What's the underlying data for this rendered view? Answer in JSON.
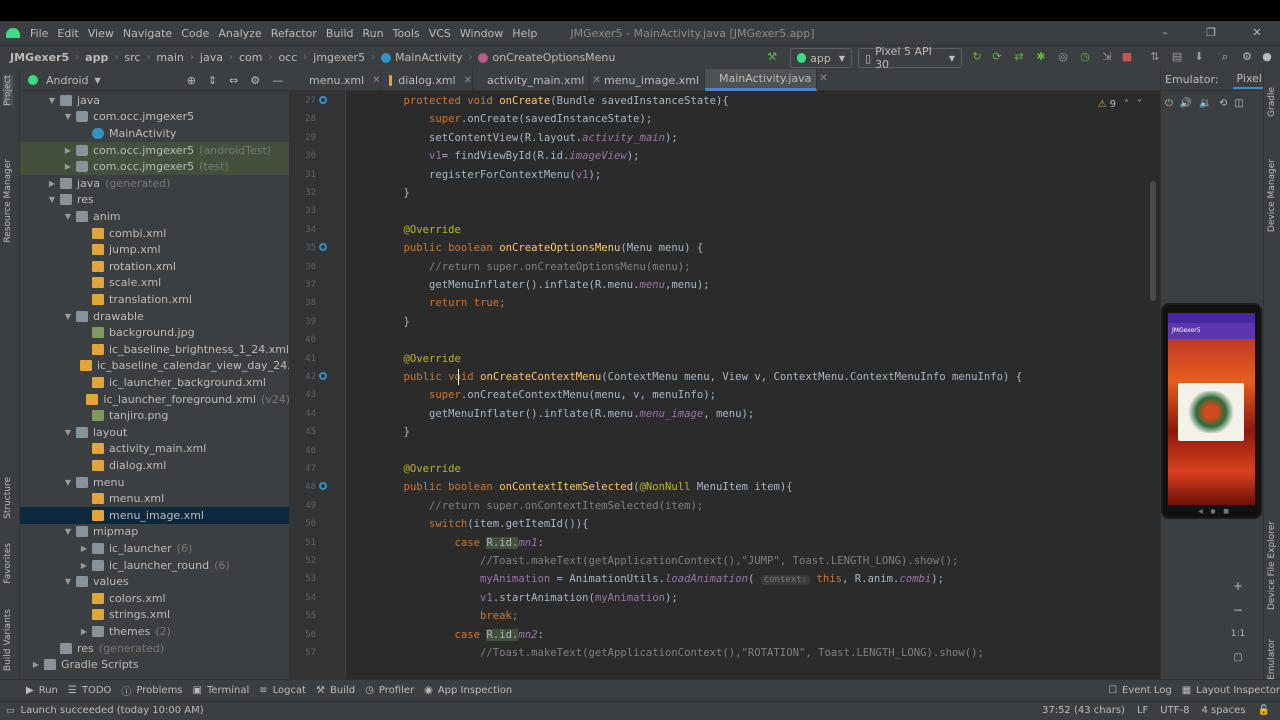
{
  "window": {
    "title": "JMGexer5 - MainActivity.java [JMGexer5.app]",
    "menu": [
      "File",
      "Edit",
      "View",
      "Navigate",
      "Code",
      "Analyze",
      "Refactor",
      "Build",
      "Run",
      "Tools",
      "VCS",
      "Window",
      "Help"
    ],
    "controls": {
      "minimize": "–",
      "restore": "❐",
      "close": "✕"
    }
  },
  "breadcrumb": [
    "JMGexer5",
    "app",
    "src",
    "main",
    "java",
    "com",
    "occ",
    "jmgexer5",
    "MainActivity",
    "onCreateOptionsMenu"
  ],
  "toolbar": {
    "run_config": "app",
    "device": "Pixel 5 API 30"
  },
  "project_panel": {
    "view": "Android",
    "tree": [
      {
        "label": "java",
        "depth": 2,
        "icon": "folder-icon",
        "arrow": "▼",
        "suffix": ""
      },
      {
        "label": "com.occ.jmgexer5",
        "depth": 3,
        "icon": "package-icon",
        "arrow": "▼",
        "suffix": ""
      },
      {
        "label": "MainActivity",
        "depth": 4,
        "icon": "class-icon",
        "arrow": "",
        "suffix": ""
      },
      {
        "label": "com.occ.jmgexer5",
        "depth": 3,
        "icon": "package-icon",
        "arrow": "▶",
        "suffix": "(androidTest)",
        "hl": true
      },
      {
        "label": "com.occ.jmgexer5",
        "depth": 3,
        "icon": "package-icon",
        "arrow": "▶",
        "suffix": "(test)",
        "hl": true
      },
      {
        "label": "java",
        "depth": 2,
        "icon": "folder-icon",
        "arrow": "▶",
        "suffix": "(generated)"
      },
      {
        "label": "res",
        "depth": 2,
        "icon": "folder-icon",
        "arrow": "▼",
        "suffix": ""
      },
      {
        "label": "anim",
        "depth": 3,
        "icon": "folder-icon",
        "arrow": "▼",
        "suffix": ""
      },
      {
        "label": "combi.xml",
        "depth": 4,
        "icon": "xml-icon",
        "arrow": "",
        "suffix": ""
      },
      {
        "label": "jump.xml",
        "depth": 4,
        "icon": "xml-icon",
        "arrow": "",
        "suffix": ""
      },
      {
        "label": "rotation.xml",
        "depth": 4,
        "icon": "xml-icon",
        "arrow": "",
        "suffix": ""
      },
      {
        "label": "scale.xml",
        "depth": 4,
        "icon": "xml-icon",
        "arrow": "",
        "suffix": ""
      },
      {
        "label": "translation.xml",
        "depth": 4,
        "icon": "xml-icon",
        "arrow": "",
        "suffix": ""
      },
      {
        "label": "drawable",
        "depth": 3,
        "icon": "folder-icon",
        "arrow": "▼",
        "suffix": ""
      },
      {
        "label": "background.jpg",
        "depth": 4,
        "icon": "image-icon",
        "arrow": "",
        "suffix": ""
      },
      {
        "label": "ic_baseline_brightness_1_24.xml",
        "depth": 4,
        "icon": "xml-icon",
        "arrow": "",
        "suffix": ""
      },
      {
        "label": "ic_baseline_calendar_view_day_24.xml",
        "depth": 4,
        "icon": "xml-icon",
        "arrow": "",
        "suffix": ""
      },
      {
        "label": "ic_launcher_background.xml",
        "depth": 4,
        "icon": "xml-icon",
        "arrow": "",
        "suffix": ""
      },
      {
        "label": "ic_launcher_foreground.xml",
        "depth": 4,
        "icon": "xml-icon",
        "arrow": "",
        "suffix": "(v24)"
      },
      {
        "label": "tanjiro.png",
        "depth": 4,
        "icon": "image-icon",
        "arrow": "",
        "suffix": ""
      },
      {
        "label": "layout",
        "depth": 3,
        "icon": "folder-icon",
        "arrow": "▼",
        "suffix": ""
      },
      {
        "label": "activity_main.xml",
        "depth": 4,
        "icon": "xml-icon",
        "arrow": "",
        "suffix": ""
      },
      {
        "label": "dialog.xml",
        "depth": 4,
        "icon": "xml-icon",
        "arrow": "",
        "suffix": ""
      },
      {
        "label": "menu",
        "depth": 3,
        "icon": "folder-icon",
        "arrow": "▼",
        "suffix": ""
      },
      {
        "label": "menu.xml",
        "depth": 4,
        "icon": "xml-icon",
        "arrow": "",
        "suffix": ""
      },
      {
        "label": "menu_image.xml",
        "depth": 4,
        "icon": "xml-icon",
        "arrow": "",
        "suffix": "",
        "sel": true
      },
      {
        "label": "mipmap",
        "depth": 3,
        "icon": "folder-icon",
        "arrow": "▼",
        "suffix": ""
      },
      {
        "label": "ic_launcher",
        "depth": 4,
        "icon": "folder-icon",
        "arrow": "▶",
        "suffix": "(6)"
      },
      {
        "label": "ic_launcher_round",
        "depth": 4,
        "icon": "folder-icon",
        "arrow": "▶",
        "suffix": "(6)"
      },
      {
        "label": "values",
        "depth": 3,
        "icon": "folder-icon",
        "arrow": "▼",
        "suffix": ""
      },
      {
        "label": "colors.xml",
        "depth": 4,
        "icon": "xml-icon",
        "arrow": "",
        "suffix": ""
      },
      {
        "label": "strings.xml",
        "depth": 4,
        "icon": "xml-icon",
        "arrow": "",
        "suffix": ""
      },
      {
        "label": "themes",
        "depth": 4,
        "icon": "folder-icon",
        "arrow": "▶",
        "suffix": "(2)"
      },
      {
        "label": "res",
        "depth": 2,
        "icon": "folder-icon",
        "arrow": "",
        "suffix": "(generated)"
      },
      {
        "label": "Gradle Scripts",
        "depth": 1,
        "icon": "gradle-icon",
        "arrow": "▶",
        "suffix": ""
      }
    ]
  },
  "left_strip": [
    "Project",
    "Resource Manager",
    "Structure",
    "Favorites",
    "Build Variants"
  ],
  "right_strip": [
    "Gradle",
    "Device Manager",
    "Device File Explorer",
    "Emulator"
  ],
  "tabs": [
    {
      "label": "menu.xml",
      "active": false
    },
    {
      "label": "dialog.xml",
      "active": false
    },
    {
      "label": "activity_main.xml",
      "active": false
    },
    {
      "label": "menu_image.xml",
      "active": false
    },
    {
      "label": "MainActivity.java",
      "active": true
    }
  ],
  "inspections": {
    "warnings": "9"
  },
  "code_lines": [
    {
      "n": "27",
      "mark": true,
      "t": [
        [
          "kw",
          "    protected void "
        ],
        [
          "fn",
          "onCreate"
        ],
        [
          "",
          "(Bundle savedInstanceState){"
        ]
      ]
    },
    {
      "n": "28",
      "t": [
        [
          "",
          "        "
        ],
        [
          "kw",
          "super"
        ],
        [
          "",
          ".onCreate(savedInstanceState);"
        ]
      ]
    },
    {
      "n": "29",
      "t": [
        [
          "",
          "        setContentView(R.layout."
        ],
        [
          "fld",
          "activity_main"
        ],
        [
          "",
          ");"
        ]
      ]
    },
    {
      "n": "30",
      "t": [
        [
          "",
          "        "
        ],
        [
          "ifld",
          "v1"
        ],
        [
          "",
          "= findViewById(R.id."
        ],
        [
          "fld",
          "imageView"
        ],
        [
          "",
          ");"
        ]
      ]
    },
    {
      "n": "31",
      "t": [
        [
          "",
          "        registerForContextMenu("
        ],
        [
          "ifld",
          "v1"
        ],
        [
          "",
          ");"
        ]
      ]
    },
    {
      "n": "32",
      "t": [
        [
          "",
          "    }"
        ]
      ]
    },
    {
      "n": "33",
      "t": [
        [
          "",
          ""
        ]
      ]
    },
    {
      "n": "34",
      "t": [
        [
          "an",
          "    @Override"
        ]
      ]
    },
    {
      "n": "35",
      "mark": true,
      "t": [
        [
          "kw",
          "    public boolean "
        ],
        [
          "fn",
          "onCreateOptionsMenu"
        ],
        [
          "",
          "(Menu menu) {"
        ]
      ]
    },
    {
      "n": "36",
      "t": [
        [
          "cm",
          "        //return super.onCreateOptionsMenu(menu);"
        ]
      ]
    },
    {
      "n": "37",
      "t": [
        [
          "",
          "        getMenuInflater().inflate(R.menu."
        ],
        [
          "fld",
          "menu"
        ],
        [
          "",
          ",menu);"
        ]
      ]
    },
    {
      "n": "38",
      "t": [
        [
          "kw",
          "        return true;"
        ]
      ]
    },
    {
      "n": "39",
      "t": [
        [
          "",
          "    }"
        ]
      ]
    },
    {
      "n": "40",
      "t": [
        [
          "",
          ""
        ]
      ]
    },
    {
      "n": "41",
      "t": [
        [
          "an",
          "    @Override"
        ]
      ]
    },
    {
      "n": "42",
      "mark": true,
      "t": [
        [
          "kw",
          "    public void "
        ],
        [
          "fn",
          "onCreateContextMenu"
        ],
        [
          "",
          "(ContextMenu menu, View v, ContextMenu.ContextMenuInfo menuInfo) {"
        ]
      ]
    },
    {
      "n": "43",
      "t": [
        [
          "",
          "        "
        ],
        [
          "kw",
          "super"
        ],
        [
          "",
          ".onCreateContextMenu(menu, v, menuInfo);"
        ]
      ]
    },
    {
      "n": "44",
      "t": [
        [
          "",
          "        getMenuInflater().inflate(R.menu."
        ],
        [
          "fld",
          "menu_image"
        ],
        [
          "",
          ", menu);"
        ]
      ]
    },
    {
      "n": "45",
      "t": [
        [
          "",
          "    }"
        ]
      ]
    },
    {
      "n": "46",
      "t": [
        [
          "",
          ""
        ]
      ]
    },
    {
      "n": "47",
      "t": [
        [
          "an",
          "    @Override"
        ]
      ]
    },
    {
      "n": "48",
      "mark": true,
      "t": [
        [
          "kw",
          "    public boolean "
        ],
        [
          "fn",
          "onContextItemSelected"
        ],
        [
          "",
          "("
        ],
        [
          "an",
          "@NonNull"
        ],
        [
          "",
          " MenuItem item){"
        ]
      ]
    },
    {
      "n": "49",
      "t": [
        [
          "cm",
          "        //return super.onContextItemSelected(item);"
        ]
      ]
    },
    {
      "n": "50",
      "t": [
        [
          "kw",
          "        switch"
        ],
        [
          "",
          "(item.getItemId()){"
        ]
      ]
    },
    {
      "n": "51",
      "t": [
        [
          "kw",
          "            case "
        ],
        [
          "hr",
          "R.id."
        ],
        [
          "fld",
          "mn1"
        ],
        [
          "",
          ":"
        ]
      ]
    },
    {
      "n": "52",
      "t": [
        [
          "cm",
          "                //Toast.makeText(getApplicationContext(),\"JUMP\", Toast.LENGTH_LONG).show();"
        ]
      ]
    },
    {
      "n": "53",
      "t": [
        [
          "ifld",
          "                myAnimation"
        ],
        [
          "",
          " = AnimationUtils."
        ],
        [
          "fld",
          "loadAnimation"
        ],
        [
          "",
          "( "
        ],
        [
          "hint",
          "context:"
        ],
        [
          "kw",
          " this"
        ],
        [
          "",
          ", R.anim."
        ],
        [
          "fld",
          "combi"
        ],
        [
          "",
          ");"
        ]
      ]
    },
    {
      "n": "54",
      "t": [
        [
          "ifld",
          "                v1"
        ],
        [
          "",
          ".startAnimation("
        ],
        [
          "ifld",
          "myAnimation"
        ],
        [
          "",
          ");"
        ]
      ]
    },
    {
      "n": "55",
      "t": [
        [
          "kw",
          "                break;"
        ]
      ]
    },
    {
      "n": "56",
      "t": [
        [
          "kw",
          "            case "
        ],
        [
          "hr",
          "R.id."
        ],
        [
          "fld",
          "mn2"
        ],
        [
          "",
          ":"
        ]
      ]
    },
    {
      "n": "57",
      "t": [
        [
          "cm",
          "                //Toast.makeText(getApplicationContext(),\"ROTATION\", Toast.LENGTH_LONG).show();"
        ]
      ]
    }
  ],
  "emulator": {
    "label": "Emulator:",
    "device_tab": "Pixel",
    "app_title": "JMGexer5",
    "zoom_ratio": "1:1"
  },
  "bottom_tools": [
    {
      "label": "Run",
      "icon": "run-icon"
    },
    {
      "label": "TODO",
      "icon": "todo-icon"
    },
    {
      "label": "Problems",
      "icon": "problems-icon"
    },
    {
      "label": "Terminal",
      "icon": "terminal-icon"
    },
    {
      "label": "Logcat",
      "icon": "logcat-icon"
    },
    {
      "label": "Build",
      "icon": "build-icon"
    },
    {
      "label": "Profiler",
      "icon": "profiler-icon"
    },
    {
      "label": "App Inspection",
      "icon": "app-inspection-icon"
    }
  ],
  "bottom_right_tools": [
    {
      "label": "Event Log",
      "icon": "event-log-icon"
    },
    {
      "label": "Layout Inspector",
      "icon": "layout-inspector-icon"
    }
  ],
  "status": {
    "message": "Launch succeeded (today 10:00 AM)",
    "position": "37:52 (43 chars)",
    "line_sep": "LF",
    "encoding": "UTF-8",
    "indent": "4 spaces"
  },
  "colors": {
    "accent": "#4a88c7",
    "selection": "#0d293e",
    "keyword": "#cc7832",
    "function": "#ffc66d",
    "annotation": "#bbb529",
    "comment": "#808080",
    "field": "#9876aa"
  }
}
